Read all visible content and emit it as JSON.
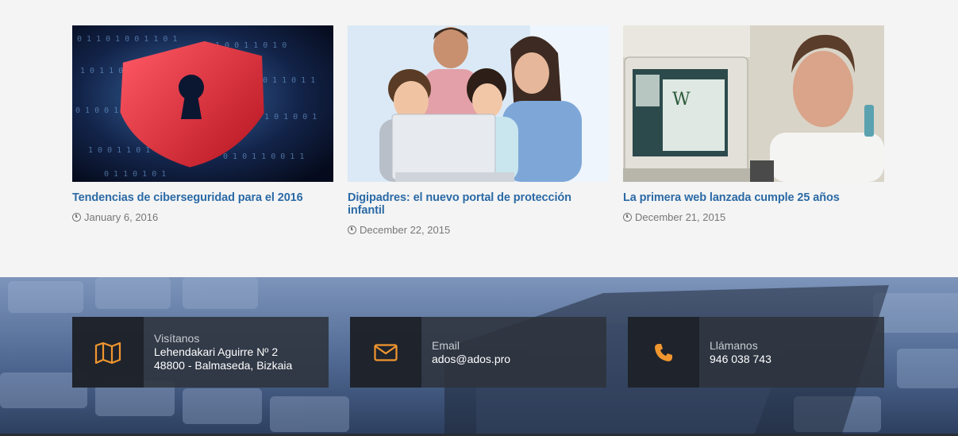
{
  "posts": [
    {
      "title": "Tendencias de ciberseguridad para el 2016",
      "date": "January 6, 2016",
      "image": "cybersecurity-shield-keyhole"
    },
    {
      "title": "Digipadres: el nuevo portal de protección infantil",
      "date": "December 22, 2015",
      "image": "family-with-laptop"
    },
    {
      "title": "La primera web lanzada cumple 25 años",
      "date": "December 21, 2015",
      "image": "man-with-old-computer"
    }
  ],
  "contact": {
    "visit": {
      "label": "Visítanos",
      "line1": "Lehendakari Aguirre Nº 2",
      "line2": "48800 - Balmaseda, Bizkaia",
      "icon": "map-icon"
    },
    "email": {
      "label": "Email",
      "value": "ados@ados.pro",
      "icon": "envelope-icon"
    },
    "phone": {
      "label": "Llámanos",
      "value": "946 038 743",
      "icon": "phone-icon"
    }
  },
  "colors": {
    "accent": "#f0962e",
    "link": "#2b6aa6",
    "panel": "#2e333c"
  }
}
